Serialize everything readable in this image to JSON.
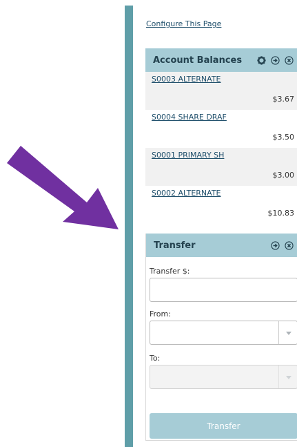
{
  "configure_link": "Configure This Page",
  "balances": {
    "title": "Account Balances",
    "accounts": [
      {
        "name": "S0003 ALTERNATE",
        "amount": "$3.67"
      },
      {
        "name": "S0004 SHARE DRAF",
        "amount": "$3.50"
      },
      {
        "name": "S0001 PRIMARY SH",
        "amount": "$3.00"
      },
      {
        "name": "S0002 ALTERNATE",
        "amount": "$10.83"
      }
    ]
  },
  "transfer": {
    "title": "Transfer",
    "amount_label": "Transfer $:",
    "amount_value": "",
    "from_label": "From:",
    "from_value": "",
    "to_label": "To:",
    "to_value": "",
    "button_label": "Transfer"
  },
  "icons": {
    "settings": "gear-icon",
    "collapse": "circle-arrow-icon",
    "close": "circle-close-icon",
    "annotation": "arrow-pointer-icon"
  },
  "colors": {
    "accent_bar": "#5f9ea8",
    "panel_header": "#a6ccd6",
    "link": "#1f4f6b",
    "annotation_arrow": "#7030a0"
  }
}
